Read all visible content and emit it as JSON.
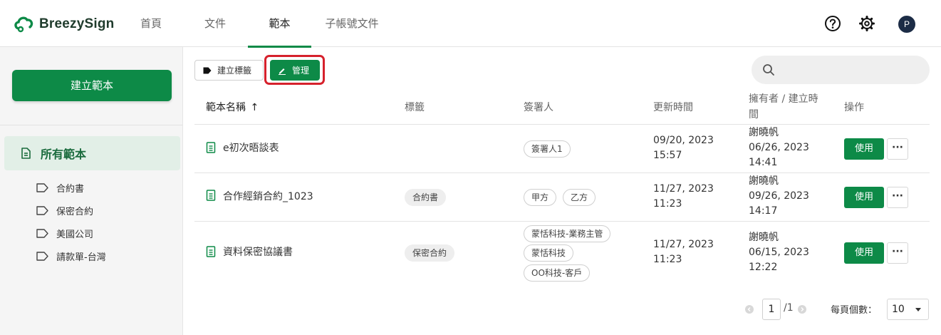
{
  "app": {
    "brand": "BreezySign",
    "accent": "#0d8a47",
    "highlight": "#d6212c"
  },
  "nav": {
    "tabs": [
      {
        "label": "首頁"
      },
      {
        "label": "文件"
      },
      {
        "label": "範本",
        "active": true
      },
      {
        "label": "子帳號文件"
      }
    ],
    "icons": [
      "help-icon",
      "gear-icon"
    ],
    "avatar": "P"
  },
  "sidebar": {
    "create_label": "建立範本",
    "all_label": "所有範本",
    "tags": [
      {
        "label": "合約書"
      },
      {
        "label": "保密合約"
      },
      {
        "label": "美國公司"
      },
      {
        "label": "請款單-台灣"
      }
    ]
  },
  "toolbar": {
    "create_tag_label": "建立標籤",
    "manage_label": "管理",
    "search_placeholder": ""
  },
  "table": {
    "headers": {
      "name": "範本名稱",
      "tag": "標籤",
      "signers": "簽署人",
      "updated": "更新時間",
      "owner": "擁有者 / 建立時間",
      "actions": "操作"
    },
    "sort_indicator": "↑",
    "rows": [
      {
        "name": "e初次晤談表",
        "tag": "",
        "signers": [
          "簽署人1"
        ],
        "updated_date": "09/20, 2023",
        "updated_time": "15:57",
        "owner": "謝曉帆",
        "created_date": "06/26, 2023",
        "created_time": "14:41",
        "use_label": "使用",
        "more_label": "···"
      },
      {
        "name": "合作經銷合約_1023",
        "tag": "合約書",
        "signers": [
          "甲方",
          "乙方"
        ],
        "updated_date": "11/27, 2023",
        "updated_time": "11:23",
        "owner": "謝曉帆",
        "created_date": "09/26, 2023",
        "created_time": "14:17",
        "use_label": "使用",
        "more_label": "···"
      },
      {
        "name": "資料保密協議書",
        "tag": "保密合約",
        "signers": [
          "蒙恬科技-業務主管",
          "蒙恬科技",
          "OO科技-客戶"
        ],
        "updated_date": "11/27, 2023",
        "updated_time": "11:23",
        "owner": "謝曉帆",
        "created_date": "06/15, 2023",
        "created_time": "12:22",
        "use_label": "使用",
        "more_label": "···"
      }
    ]
  },
  "pagination": {
    "current_page": "1",
    "total_pages": "/1",
    "per_page_label": "每頁個數：",
    "per_page_value": "10"
  }
}
